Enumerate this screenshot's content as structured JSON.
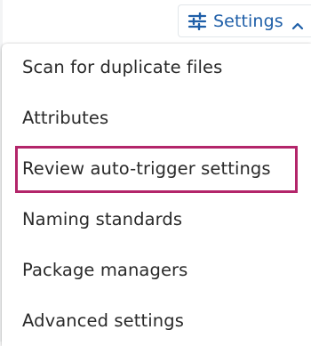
{
  "toolbar": {
    "settings_label": "Settings",
    "settings_icon": "sliders-icon",
    "chevron_icon": "chevron-up-icon"
  },
  "menu": {
    "items": [
      {
        "label": "Scan for duplicate files"
      },
      {
        "label": "Attributes"
      },
      {
        "label": "Review auto-trigger settings",
        "highlighted": true
      },
      {
        "label": "Naming standards"
      },
      {
        "label": "Package managers"
      },
      {
        "label": "Advanced settings"
      }
    ]
  },
  "colors": {
    "accent": "#1f5fa8",
    "highlight_border": "#b3256a",
    "text": "#2a2a2a"
  }
}
